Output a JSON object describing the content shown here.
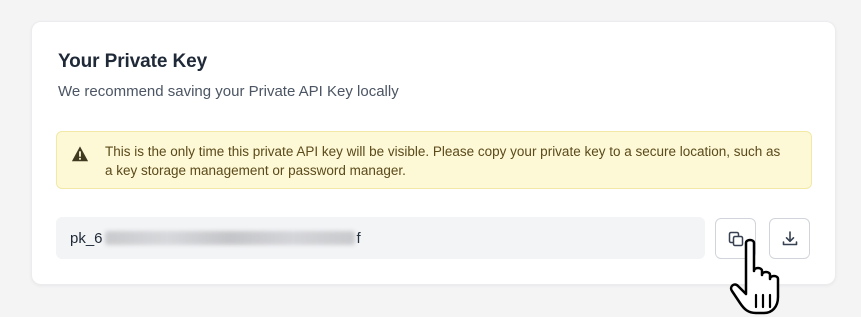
{
  "private_key": {
    "title": "Your Private Key",
    "subtitle": "We recommend saving your Private API Key locally",
    "warning": "This is the only time this private API key will be visible. Please copy your private key to a secure location, such as a key storage management or password manager.",
    "key_prefix": "pk_6",
    "key_suffix": "f",
    "copy_icon": "copy-icon",
    "download_icon": "download-icon",
    "warning_icon": "warning-triangle-icon"
  },
  "colors": {
    "warning_bg": "#fdf8d6",
    "warning_text": "#5b4a1a",
    "field_bg": "#f3f4f6"
  }
}
